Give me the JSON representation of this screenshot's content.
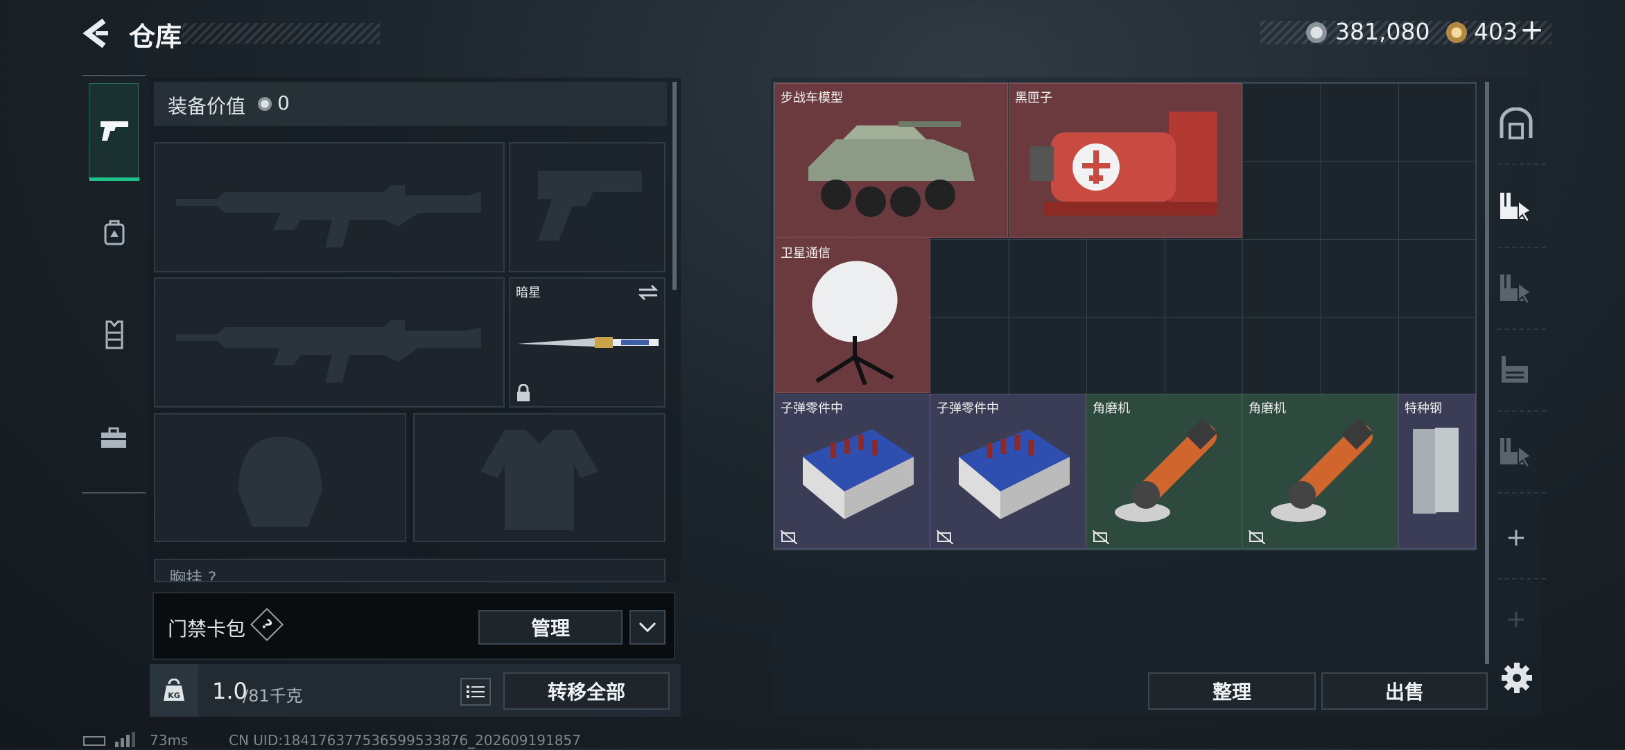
{
  "header": {
    "title": "仓库",
    "currency_main": "381,080",
    "currency_secondary": "403",
    "plus_label": "+"
  },
  "equipment": {
    "value_label": "装备价值",
    "value": "0",
    "melee_label": "暗星",
    "partial_row_label": "胸挂 ?"
  },
  "keycard": {
    "label": "门禁卡包",
    "help": "?",
    "manage_label": "管理"
  },
  "weight": {
    "current": "1.0",
    "max": "/81千克",
    "kg_badge": "KG"
  },
  "bottom": {
    "transfer_all_label": "转移全部"
  },
  "storage": {
    "items": [
      {
        "label": "步战车模型",
        "rarity": "red"
      },
      {
        "label": "黑匣子",
        "rarity": "red"
      },
      {
        "label": "卫星通信",
        "rarity": "red"
      },
      {
        "label": "子弹零件中",
        "rarity": "purple"
      },
      {
        "label": "子弹零件中",
        "rarity": "purple"
      },
      {
        "label": "角磨机",
        "rarity": "green"
      },
      {
        "label": "角磨机",
        "rarity": "green"
      },
      {
        "label": "特种钢",
        "rarity": "purple"
      }
    ],
    "sort_label": "整理",
    "sell_label": "出售"
  },
  "right_rail": {
    "add_label": "+",
    "add_disabled_label": "+"
  },
  "status_bar": {
    "ping": "73ms",
    "uid": "CN UID:184176377536599533876_202609191857"
  },
  "colors": {
    "red_item": "#6a3a3e",
    "purple_item": "#3b3c55",
    "green_item": "#2e4a3f",
    "accent_green": "#22c08a"
  }
}
